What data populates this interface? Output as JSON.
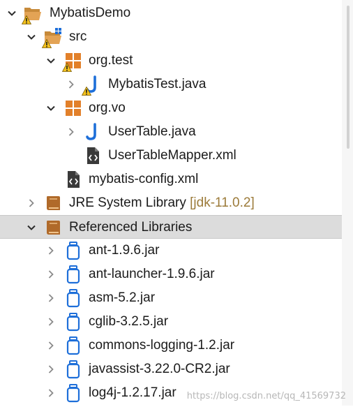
{
  "tree": {
    "project": "MybatisDemo",
    "src": "src",
    "pkg_test": "org.test",
    "file_mybatistest": "MybatisTest.java",
    "pkg_vo": "org.vo",
    "file_usertable": "UserTable.java",
    "file_usertablemapper": "UserTableMapper.xml",
    "file_config": "mybatis-config.xml",
    "jre_label": "JRE System Library",
    "jre_version": "[jdk-11.0.2]",
    "ref_libs": "Referenced Libraries",
    "jars": [
      "ant-1.9.6.jar",
      "ant-launcher-1.9.6.jar",
      "asm-5.2.jar",
      "cglib-3.2.5.jar",
      "commons-logging-1.2.jar",
      "javassist-3.22.0-CR2.jar",
      "log4j-1.2.17.jar"
    ]
  },
  "watermark": "https://blog.csdn.net/qq_41569732",
  "colors": {
    "selection": "#dcdcdc",
    "java_blue": "#1e6fd9",
    "package_orange": "#e2802a",
    "library_brown": "#b06a2a",
    "warning_yellow": "#f4c21d",
    "jre_version_text": "#9c7b3a"
  }
}
